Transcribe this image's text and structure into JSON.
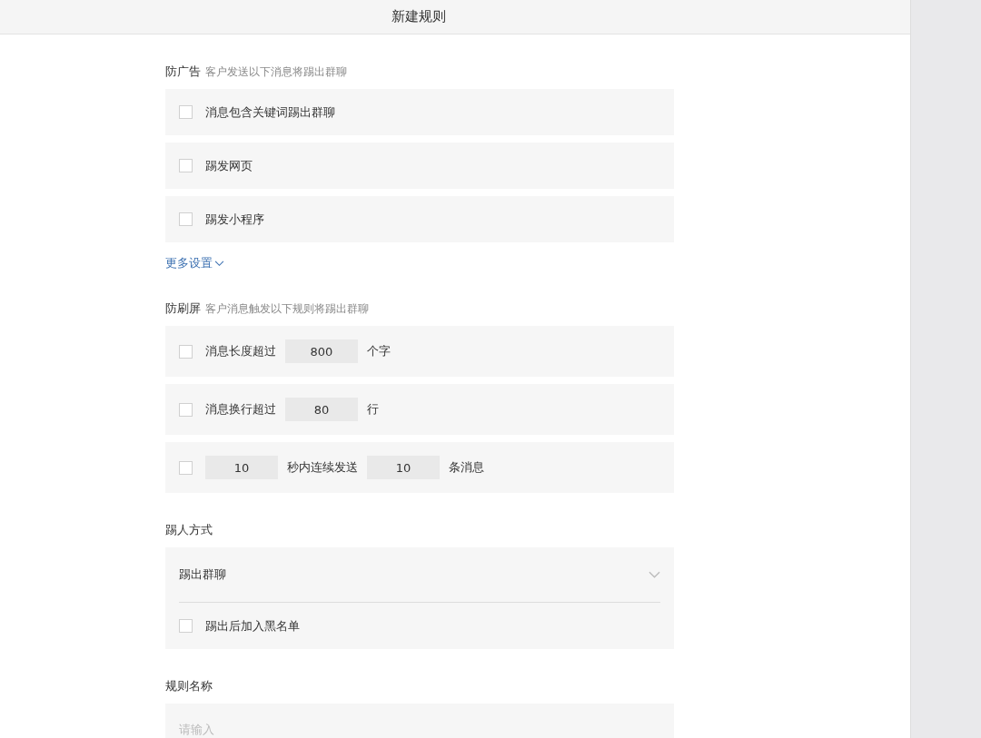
{
  "header": {
    "title": "新建规则"
  },
  "sections": [
    {
      "title": "防广告",
      "hint": "客户发送以下消息将踢出群聊",
      "more_link": "更多设置",
      "rows": [
        {
          "checked": false,
          "parts": [
            {
              "kind": "text",
              "text": "消息包含关键词踢出群聊"
            }
          ]
        },
        {
          "checked": false,
          "parts": [
            {
              "kind": "text",
              "text": "踢发网页"
            }
          ]
        },
        {
          "checked": false,
          "parts": [
            {
              "kind": "text",
              "text": "踢发小程序"
            }
          ]
        }
      ]
    },
    {
      "title": "防刷屏",
      "hint": "客户消息触发以下规则将踢出群聊",
      "rows": [
        {
          "checked": false,
          "parts": [
            {
              "kind": "text",
              "text": "消息长度超过"
            },
            {
              "kind": "input",
              "value": "800"
            },
            {
              "kind": "text",
              "text": "个字"
            }
          ]
        },
        {
          "checked": false,
          "parts": [
            {
              "kind": "text",
              "text": "消息换行超过"
            },
            {
              "kind": "input",
              "value": "80"
            },
            {
              "kind": "text",
              "text": "行"
            }
          ]
        },
        {
          "checked": false,
          "parts": [
            {
              "kind": "input",
              "value": "10"
            },
            {
              "kind": "text",
              "text": "秒内连续发送"
            },
            {
              "kind": "input",
              "value": "10"
            },
            {
              "kind": "text",
              "text": "条消息"
            }
          ]
        }
      ]
    }
  ],
  "kick_method": {
    "label": "踢人方式",
    "select_value": "踢出群聊",
    "blacklist": {
      "label": "踢出后加入黑名单",
      "checked": false
    }
  },
  "rule_name": {
    "label": "规则名称",
    "placeholder": "请输入"
  }
}
